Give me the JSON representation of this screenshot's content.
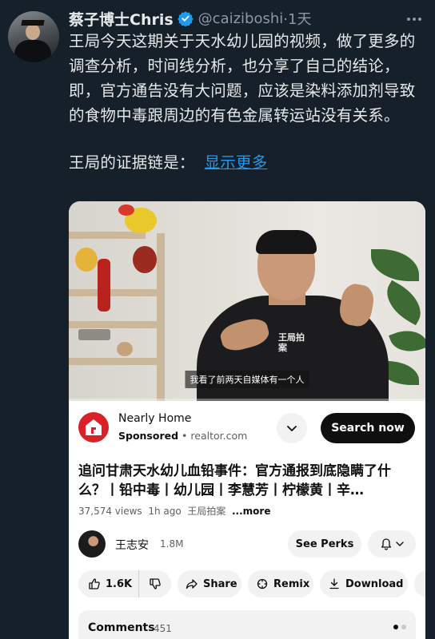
{
  "tweet": {
    "author_name": "蔡子博士Chris",
    "author_handle": "@caiziboshi",
    "time": "·1天",
    "paragraph_1": "王局今天这期关于天水幼儿园的视频，做了更多的调查分析，时间线分析，也分享了自己的结论，即，官方通告没有大问题，应该是染料添加剂导致的食物中毒跟周边的有色金属转运站没有关系。",
    "paragraph_2": "王局的证据链是：",
    "show_more": "显示更多",
    "verified_color": "#1d9bf0",
    "link_color": "#1d9bf0",
    "icons": [
      "verified-badge-icon",
      "more-options-icon"
    ]
  },
  "video": {
    "subtitle": "我看了前两天自媒体有一个人",
    "shirt_text": "王局拍案",
    "progress": 0.0,
    "progress_color": "#ff0000"
  },
  "ad": {
    "title": "Nearly Home",
    "sponsored": "Sponsored",
    "domain": "realtor.com",
    "cta": "Search now",
    "brand_color": "#d92228"
  },
  "youtube": {
    "title": "追问甘肃天水幼儿血铅事件：官方通报到底隐瞒了什么？丨铅中毒丨幼儿园丨李慧芳丨柠檬黄丨辛…",
    "views": "37,574 views",
    "age": "1h ago",
    "tag": "王局拍案",
    "more": "...more",
    "channel_name": "王志安",
    "subscribers": "1.8M",
    "perks": "See Perks",
    "likes": "1.6K",
    "share": "Share",
    "remix": "Remix",
    "download": "Download",
    "comments_label": "Comments",
    "comments_count": "451"
  }
}
